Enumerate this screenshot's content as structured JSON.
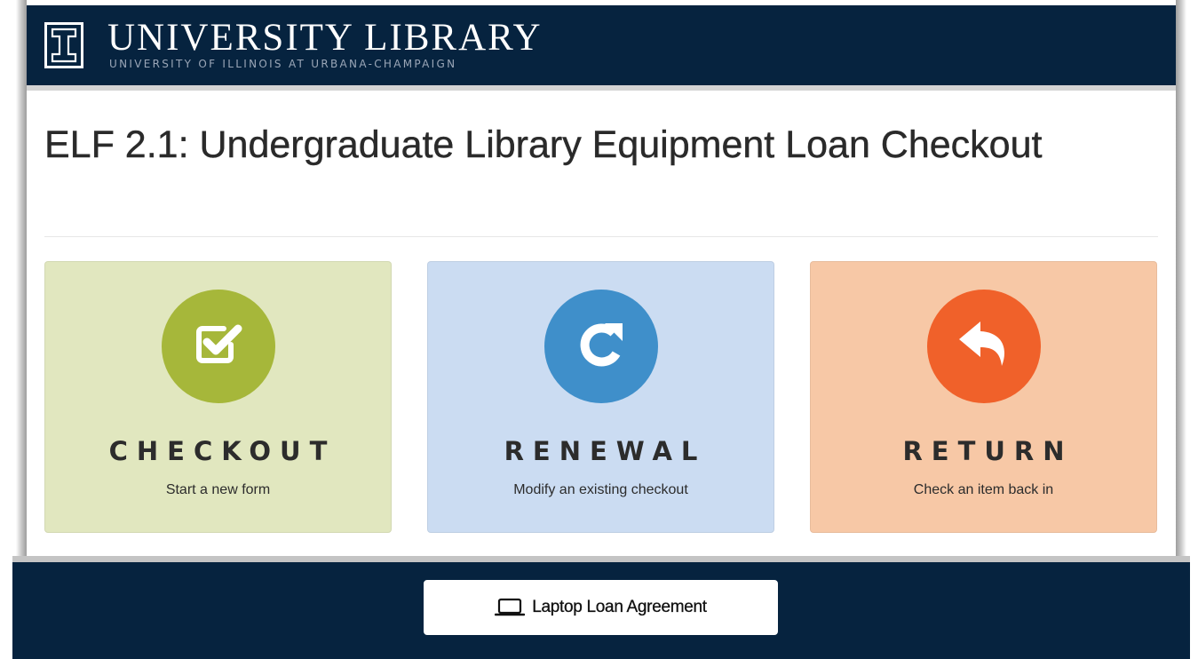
{
  "header": {
    "logo_title": "UNIVERSITY LIBRARY",
    "logo_subtitle": "UNIVERSITY OF ILLINOIS AT URBANA-CHAMPAIGN",
    "logo_icon": "block-i-icon",
    "background_color": "#06233f"
  },
  "main": {
    "page_title": "ELF 2.1: Undergraduate Library Equipment Loan Checkout",
    "cards": [
      {
        "title": "CHECKOUT",
        "subtitle": "Start a new form",
        "icon": "checkbox-icon",
        "card_color": "#e1e7bf",
        "icon_color": "#a6b73a"
      },
      {
        "title": "RENEWAL",
        "subtitle": "Modify an existing checkout",
        "icon": "refresh-icon",
        "card_color": "#cbdcf2",
        "icon_color": "#3f8fca"
      },
      {
        "title": "RETURN",
        "subtitle": "Check an item back in",
        "icon": "reply-arrow-icon",
        "card_color": "#f7c8a6",
        "icon_color": "#f0612a"
      }
    ]
  },
  "footer": {
    "loan_button_label": "Laptop Loan Agreement",
    "loan_button_icon": "laptop-icon",
    "background_color": "#06233f"
  }
}
